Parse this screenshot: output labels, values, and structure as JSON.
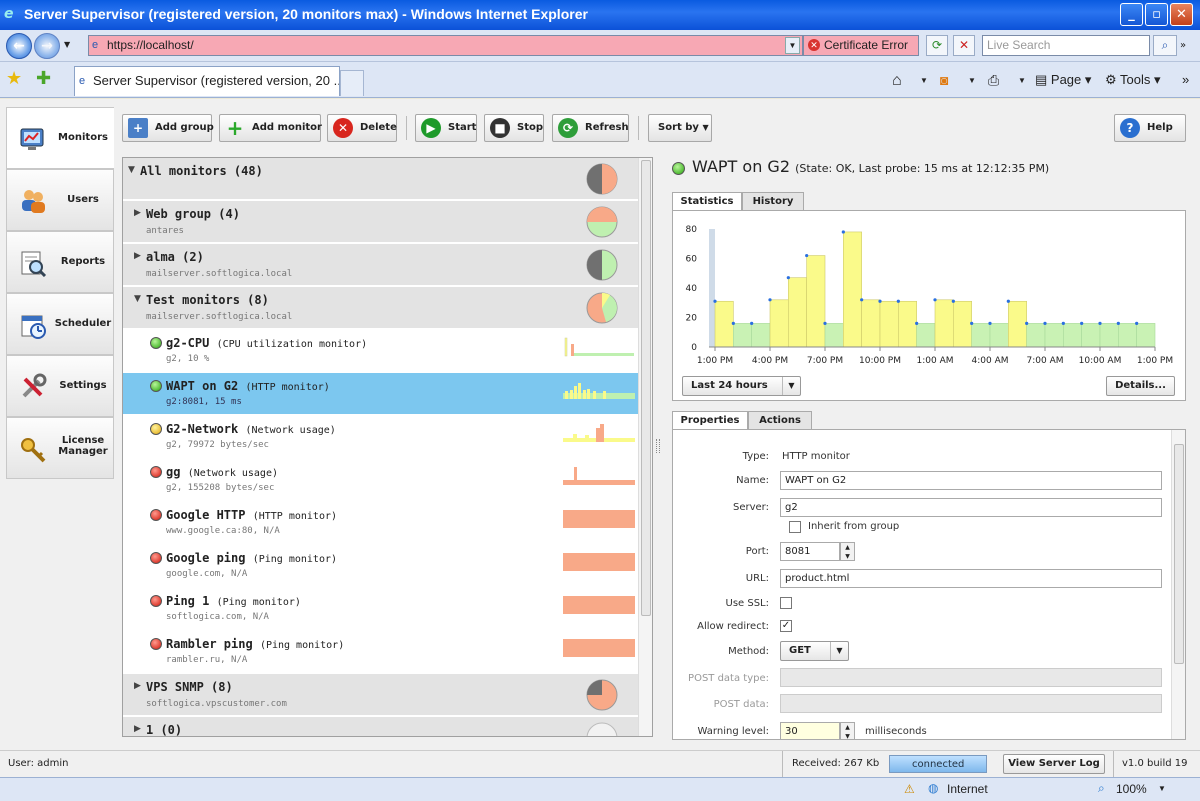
{
  "window": {
    "title": "Server Supervisor (registered version, 20 monitors max) - Windows Internet Explorer",
    "url": "https://localhost/",
    "cert_error": "Certificate Error",
    "search_placeholder": "Live Search",
    "tab_title": "Server Supervisor (registered version, 20 ...",
    "page_menu": "Page",
    "tools_menu": "Tools"
  },
  "nav": {
    "items": [
      {
        "label": "Monitors"
      },
      {
        "label": "Users"
      },
      {
        "label": "Reports"
      },
      {
        "label": "Scheduler"
      },
      {
        "label": "Settings"
      },
      {
        "label": "License Manager"
      }
    ]
  },
  "toolbar": {
    "add_group": "Add group",
    "add_monitor": "Add monitor",
    "delete": "Delete",
    "start": "Start",
    "stop": "Stop",
    "refresh": "Refresh",
    "sort_by": "Sort by",
    "help": "Help"
  },
  "tree": {
    "all": {
      "name": "All monitors (48)"
    },
    "web": {
      "name": "Web group (4)",
      "sub": "antares"
    },
    "alma": {
      "name": "alma (2)",
      "sub": "mailserver.softlogica.local"
    },
    "test": {
      "name": "Test monitors (8)",
      "sub": "mailserver.softlogica.local"
    },
    "monitors": [
      {
        "name": "g2-CPU",
        "type": "(CPU utilization monitor)",
        "sub": "g2, 10 %",
        "status": "green"
      },
      {
        "name": "WAPT on G2",
        "type": "(HTTP monitor)",
        "sub": "g2:8081, 15 ms",
        "status": "green"
      },
      {
        "name": "G2-Network",
        "type": "(Network usage)",
        "sub": "g2, 79972 bytes/sec",
        "status": "yellow"
      },
      {
        "name": "gg",
        "type": "(Network usage)",
        "sub": "g2, 155208 bytes/sec",
        "status": "red"
      },
      {
        "name": "Google HTTP",
        "type": "(HTTP monitor)",
        "sub": "www.google.ca:80, N/A",
        "status": "red"
      },
      {
        "name": "Google ping",
        "type": "(Ping monitor)",
        "sub": "google.com, N/A",
        "status": "red"
      },
      {
        "name": "Ping 1",
        "type": "(Ping monitor)",
        "sub": "softlogica.com, N/A",
        "status": "red"
      },
      {
        "name": "Rambler ping",
        "type": "(Ping monitor)",
        "sub": "rambler.ru, N/A",
        "status": "red"
      }
    ],
    "vps": {
      "name": "VPS SNMP (8)",
      "sub": "softlogica.vpscustomer.com"
    },
    "one": {
      "name": "1 (0)"
    }
  },
  "detail": {
    "title": "WAPT on G2",
    "state": "(State: OK, Last probe: 15 ms at 12:12:35 PM)",
    "tabs": [
      "Statistics",
      "History"
    ],
    "range": "Last 24 hours",
    "details_btn": "Details...",
    "prop_tabs": [
      "Properties",
      "Actions"
    ],
    "props": {
      "type_label": "Type:",
      "type_value": "HTTP monitor",
      "name_label": "Name:",
      "name_value": "WAPT on G2",
      "server_label": "Server:",
      "server_value": "g2",
      "inherit_label": "Inherit from group",
      "port_label": "Port:",
      "port_value": "8081",
      "url_label": "URL:",
      "url_value": "product.html",
      "ssl_label": "Use SSL:",
      "redirect_label": "Allow redirect:",
      "method_label": "Method:",
      "method_value": "GET",
      "postdt_label": "POST data type:",
      "postd_label": "POST data:",
      "warn_label": "Warning level:",
      "warn_value": "30",
      "warn_unit": "milliseconds"
    }
  },
  "chart_data": {
    "type": "bar",
    "ylim": [
      0,
      80
    ],
    "yticks": [
      0,
      20,
      40,
      60,
      80
    ],
    "xticks": [
      "1:00 PM",
      "4:00 PM",
      "7:00 PM",
      "10:00 PM",
      "1:00 AM",
      "4:00 AM",
      "7:00 AM",
      "10:00 AM",
      "1:00 PM"
    ],
    "values": [
      31,
      16,
      16,
      32,
      47,
      62,
      16,
      78,
      32,
      31,
      31,
      16,
      32,
      31,
      16,
      16,
      31,
      16,
      16,
      16,
      16,
      16,
      16,
      16
    ],
    "warning_level": 30,
    "colors": {
      "ok": "#c9f2b4",
      "warn": "#fafa8a",
      "dot": "#2a6fe0"
    }
  },
  "status": {
    "user": "User: admin",
    "received": "Received: 267 Kb",
    "connected": "connected",
    "view_log": "View Server Log",
    "version": "v1.0 build 19",
    "zone": "Internet",
    "zoom": "100%"
  }
}
